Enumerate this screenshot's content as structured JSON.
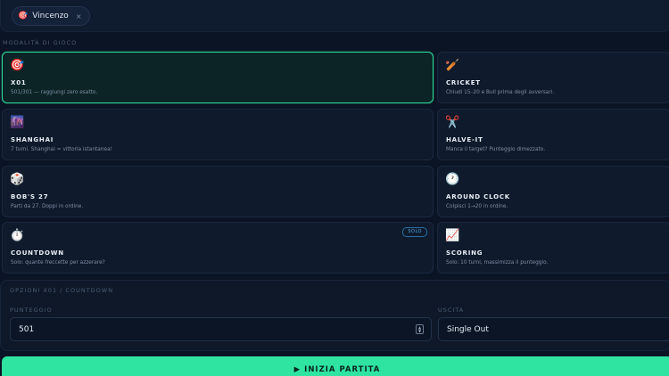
{
  "players": [
    {
      "icon": "🎯",
      "name": "Vincenzo",
      "remove": "×"
    }
  ],
  "modes_section_label": "MODALITÀ DI GIOCO",
  "modes": [
    {
      "id": "x01",
      "icon": "🎯",
      "icon_name": "target-icon",
      "title": "X01",
      "desc": "501/301 — raggiungi zero esatto.",
      "active": true
    },
    {
      "id": "cricket",
      "icon": "🏏",
      "icon_name": "cricket-bat-icon",
      "title": "CRICKET",
      "desc": "Chiudi 15–20 e Bull prima degli avversari."
    },
    {
      "id": "shanghai",
      "icon": "🌆",
      "icon_name": "city-icon",
      "title": "SHANGHAI",
      "desc": "7 turni. Shanghai = vittoria istantanea!"
    },
    {
      "id": "halve-it",
      "icon": "✂️",
      "icon_name": "scissors-icon",
      "title": "HALVE-IT",
      "desc": "Manca il target? Punteggio dimezzato."
    },
    {
      "id": "bobs-27",
      "icon": "🎲",
      "icon_name": "dice-icon",
      "title": "BOB'S 27",
      "desc": "Parti da 27. Doppi in ordine."
    },
    {
      "id": "around-clock",
      "icon": "🕐",
      "icon_name": "clock-icon",
      "title": "AROUND CLOCK",
      "desc": "Colpisci 1→20 in ordine."
    },
    {
      "id": "countdown",
      "icon": "⏱️",
      "icon_name": "stopwatch-icon",
      "title": "COUNTDOWN",
      "desc": "Solo: quante freccette per azzerare?",
      "badge": "SOLO"
    },
    {
      "id": "scoring",
      "icon": "📈",
      "icon_name": "chart-up-icon",
      "title": "SCORING",
      "desc": "Solo: 10 turni, massimizza il punteggio."
    }
  ],
  "options": {
    "section_label": "OPZIONI X01 / COUNTDOWN",
    "score_label": "PUNTEGGIO",
    "score_value": "501",
    "exit_label": "USCITA",
    "exit_value": "Single Out"
  },
  "start_button": "▶ INIZIA PARTITA",
  "colors": {
    "accent": "#2fe4a1",
    "background": "#0b1424",
    "card": "#0f1a2c",
    "badge": "#53a8e6"
  }
}
